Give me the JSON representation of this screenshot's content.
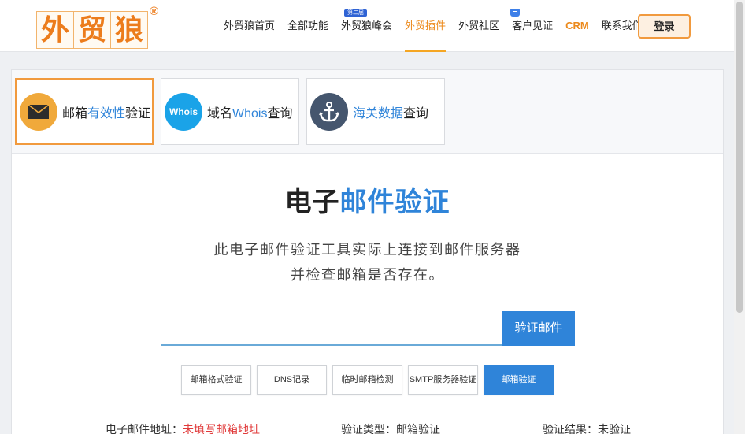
{
  "header": {
    "logo_chars": [
      "外",
      "贸",
      "狼"
    ],
    "logo_mark": "®",
    "nav": [
      {
        "label": "外贸狼首页"
      },
      {
        "label": "全部功能"
      },
      {
        "label": "外贸狼峰会",
        "badge": "第二届"
      },
      {
        "label": "外贸插件",
        "active": true
      },
      {
        "label": "外贸社区"
      },
      {
        "label": "客户见证",
        "bubble": "💬"
      },
      {
        "label": "CRM",
        "crm": true
      },
      {
        "label": "联系我们"
      }
    ],
    "login_label": "登录"
  },
  "tools": [
    {
      "pre": "邮箱",
      "hl": "有效性",
      "post": "验证",
      "icon": "envelope-icon",
      "icon_color": "#f0a93b",
      "active": true
    },
    {
      "pre": "域名",
      "hl": "Whois",
      "post": "查询",
      "icon": "whois-icon",
      "icon_text": "Whois",
      "icon_color": "#1aa3e8"
    },
    {
      "pre": "",
      "hl": "海关数据",
      "post": "查询",
      "icon": "anchor-icon",
      "icon_color": "#45566e"
    }
  ],
  "main": {
    "title_pre": "电子",
    "title_hl": "邮件验证",
    "desc_line1": "此电子邮件验证工具实际上连接到邮件服务器",
    "desc_line2": "并检查邮箱是否存在。",
    "input_placeholder": "",
    "verify_label": "验证邮件"
  },
  "chips": [
    {
      "label": "邮箱格式验证"
    },
    {
      "label": "DNS记录"
    },
    {
      "label": "临时邮箱检测"
    },
    {
      "label": "SMTP服务器验证"
    },
    {
      "label": "邮箱验证",
      "active": true
    }
  ],
  "results": {
    "address_label": "电子邮件地址：",
    "address_value": "未填写邮箱地址",
    "type_label": "验证类型：",
    "type_value": "邮箱验证",
    "result_label": "验证结果：",
    "result_value": "未验证"
  },
  "colors": {
    "accent_orange": "#ec8a1c",
    "accent_blue": "#2f84d9",
    "error_red": "#e03a3a"
  }
}
